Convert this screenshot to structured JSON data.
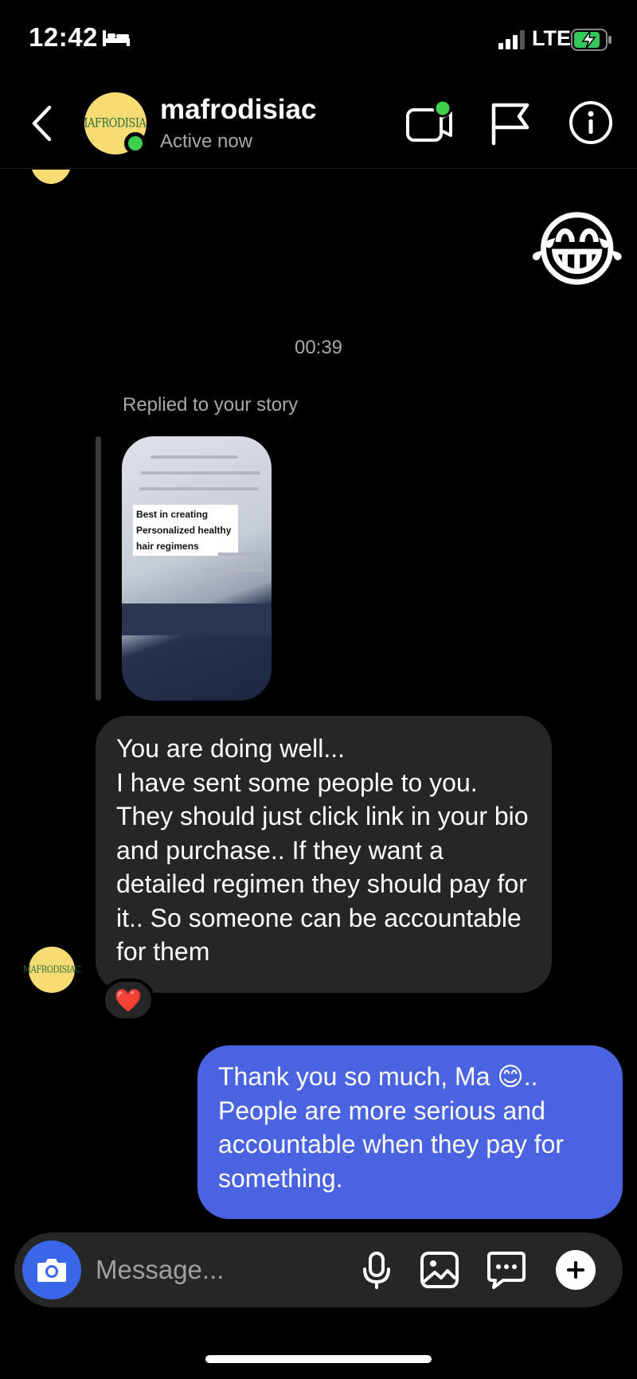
{
  "status_bar": {
    "time": "12:42",
    "network": "LTE",
    "icons": [
      "bed-icon",
      "signal-icon",
      "battery-charging-icon"
    ]
  },
  "header": {
    "contact_name": "mafrodisiac",
    "status": "Active now",
    "avatar_text": "MAFRODISIAC",
    "icons": [
      "back-icon",
      "video-call-icon",
      "flag-icon",
      "info-icon"
    ],
    "online_color": "#3dd14e"
  },
  "chat": {
    "emoji_message": "😂",
    "timestamp": "00:39",
    "story_reply_label": "Replied to your story",
    "story_caption": "Best in creating Personalized healthy hair regimens",
    "incoming_message": "You are doing well...\nI have sent some people to you.\nThey should just click link in your bio and purchase.. If they want a detailed regimen they should pay for it.. So someone can be accountable for them",
    "reaction": "❤️",
    "outgoing_message": "Thank you so much, Ma 😊.. People are more serious and accountable when they pay for something.",
    "outgoing_color": "#4a63e0",
    "incoming_color": "#262626"
  },
  "composer": {
    "placeholder": "Message...",
    "icons": [
      "camera-icon",
      "microphone-icon",
      "gallery-icon",
      "sticker-icon",
      "plus-icon"
    ],
    "camera_color": "#3a67e8"
  }
}
